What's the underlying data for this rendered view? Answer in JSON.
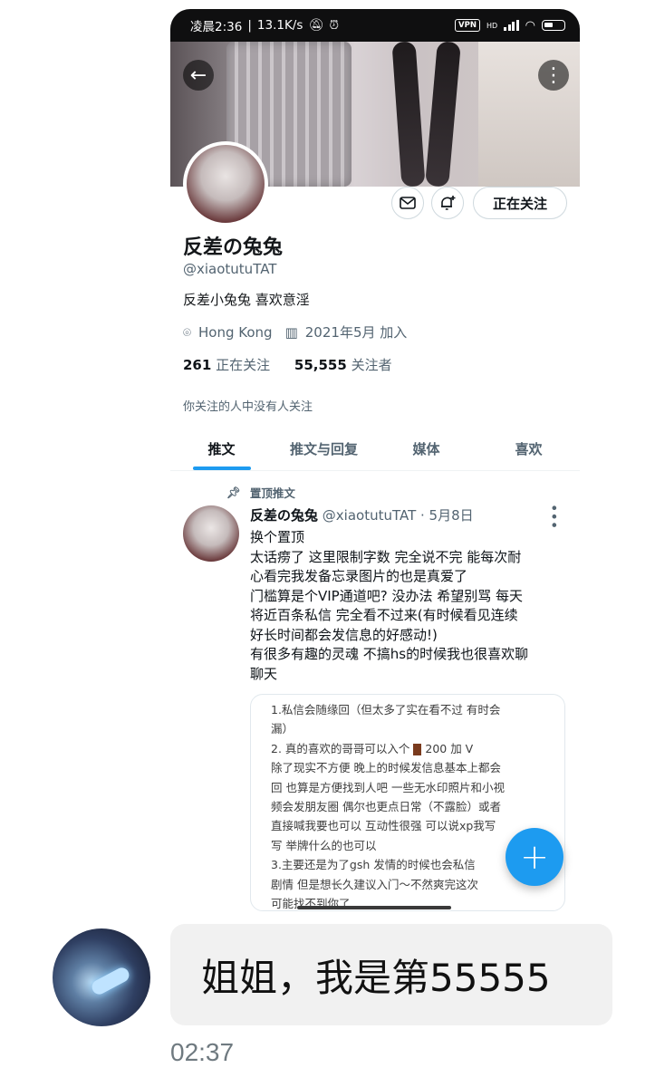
{
  "status_bar": {
    "time": "凌晨2:36",
    "speed": "13.1K/s",
    "vpn": "VPN",
    "hd": "HD"
  },
  "profile": {
    "display_name": "反差の兔兔",
    "handle": "@xiaotutuTAT",
    "bio": "反差小兔兔 喜欢意淫",
    "location": "Hong Kong",
    "joined": "2021年5月 加入",
    "following_count": "261",
    "following_label": "正在关注",
    "followers_count": "55,555",
    "followers_label": "关注者",
    "followed_by": "你关注的人中没有人关注",
    "follow_button": "正在关注"
  },
  "tabs": [
    {
      "label": "推文",
      "active": true
    },
    {
      "label": "推文与回复",
      "active": false
    },
    {
      "label": "媒体",
      "active": false
    },
    {
      "label": "喜欢",
      "active": false
    }
  ],
  "pinned_tweet": {
    "pinned_label": "置顶推文",
    "author": "反差の兔兔",
    "handle_date": "@xiaotutuTAT · 5月8日",
    "body_lines": [
      "换个置顶",
      "太话痨了 这里限制字数 完全说不完 能每次耐",
      "心看完我发备忘录图片的也是真爱了",
      "门槛算是个VIP通道吧? 没办法 希望别骂 每天",
      "将近百条私信 完全看不过来(有时候看见连续",
      "好长时间都会发信息的好感动!)",
      "有很多有趣的灵魂 不搞hs的时候我也很喜欢聊",
      "聊天"
    ],
    "memo_lines": [
      "1.私信会随缘回（但太多了实在看不过 有时会",
      "漏）",
      "2. 真的喜欢的哥哥可以入个",
      "除了现实不方便 晚上的时候发信息基本上都会",
      "回 也算是方便找到人吧 一些无水印照片和小视",
      "频会发朋友圈 偶尔也更点日常（不露脸）或者",
      "直接喊我要也可以 互动性很强 可以说xp我写",
      "写 举牌什么的也可以",
      "3.主要还是为了gsh 发情的时候也会私信",
      "剧情 但是想长久建议入门～不然爽完这次",
      "可能找不到你了"
    ],
    "memo_price": "200 加 V"
  },
  "fab": "+",
  "message": {
    "text": "姐姐，我是第55555",
    "time": "02:37"
  }
}
